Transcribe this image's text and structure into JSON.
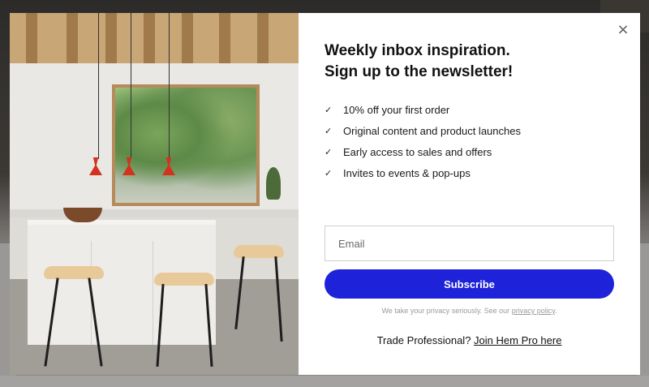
{
  "modal": {
    "close_symbol": "×",
    "title_line1": "Weekly inbox inspiration.",
    "title_line2": "Sign up to the newsletter!",
    "benefits": [
      "10% off your first order",
      "Original content and product launches",
      "Early access to sales and offers",
      "Invites to events & pop-ups"
    ],
    "check_symbol": "✓",
    "email_placeholder": "Email",
    "email_value": "",
    "subscribe_label": "Subscribe",
    "privacy_text": "We take your privacy seriously. See our",
    "privacy_link": "privacy policy",
    "privacy_end": ".",
    "trade_text": "Trade Professional?",
    "trade_link": "Join Hem Pro here"
  },
  "colors": {
    "accent": "#1e22d8",
    "lamp_red": "#d4321c"
  },
  "icons": {
    "close": "close-icon",
    "check": "check-icon"
  }
}
